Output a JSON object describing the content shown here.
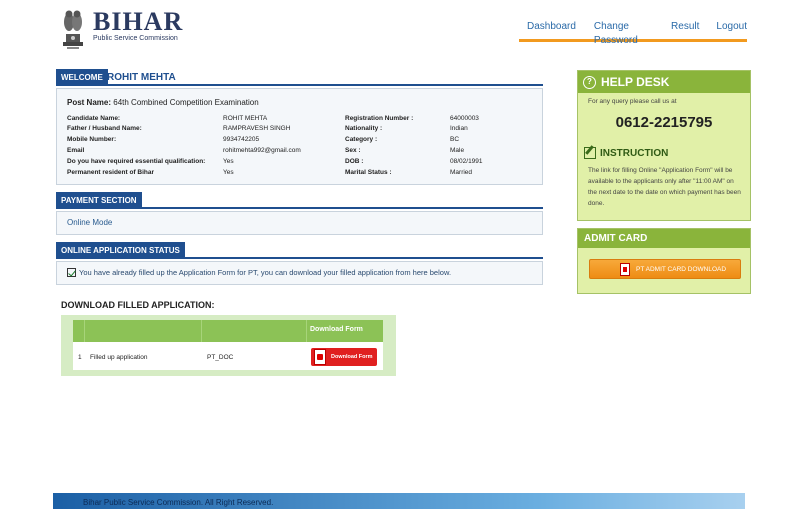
{
  "header": {
    "logo_title": "BIHAR",
    "logo_subtitle": "Public Service Commission",
    "nav": [
      "Dashboard",
      "Change Password",
      "Result",
      "Logout"
    ]
  },
  "welcome": {
    "tag": "WELCOME",
    "name": "ROHIT MEHTA",
    "post_label": "Post Name:",
    "post_value": "64th Combined Competition Examination",
    "left_fields": [
      {
        "label": "Candidate Name:",
        "value": "ROHIT MEHTA"
      },
      {
        "label": "Father / Husband Name:",
        "value": "RAMPRAVESH SINGH"
      },
      {
        "label": "Mobile Number:",
        "value": "9934742205"
      },
      {
        "label": "Email",
        "value": "rohitmehta992@gmail.com"
      },
      {
        "label": "Do you have required essential qualification:",
        "value": "Yes"
      },
      {
        "label": "Permanent resident of Bihar",
        "value": "Yes"
      }
    ],
    "right_fields": [
      {
        "label": "Registration Number :",
        "value": "64000003"
      },
      {
        "label": "Nationality :",
        "value": "Indian"
      },
      {
        "label": "Category :",
        "value": "BC"
      },
      {
        "label": "Sex :",
        "value": "Male"
      },
      {
        "label": "DOB :",
        "value": "08/02/1991"
      },
      {
        "label": "Marital Status :",
        "value": "Married"
      }
    ]
  },
  "payment": {
    "tag": "PAYMENT SECTION",
    "mode": "Online Mode"
  },
  "status": {
    "tag": "ONLINE APPLICATION STATUS",
    "message": "You have already filled up the Application Form for PT, you can download your filled application from here below."
  },
  "download": {
    "title": "DOWNLOAD FILLED APPLICATION:",
    "column_header": "Download Form",
    "row": {
      "sno": "1",
      "name": "Filled up application",
      "code": "PT_DOC",
      "button": "Download Form"
    }
  },
  "helpdesk": {
    "title": "HELP DESK",
    "line": "For any query please call us at",
    "phone": "0612-2215795",
    "instruction_title": "INSTRUCTION",
    "instruction_text": "The link for filling Online \"Application Form\" will be available to the applicants only after \"11:00 AM\" on the next date to the date on which payment has been done."
  },
  "admit_card": {
    "title": "ADMIT CARD",
    "button": "PT ADMIT CARD DOWNLOAD"
  },
  "footer": {
    "text": "Bihar Public Service Commission. All Right Reserved."
  },
  "colors": {
    "primary_blue": "#1f4f8f",
    "accent_orange": "#f29a1f",
    "help_green": "#8ab43b"
  }
}
